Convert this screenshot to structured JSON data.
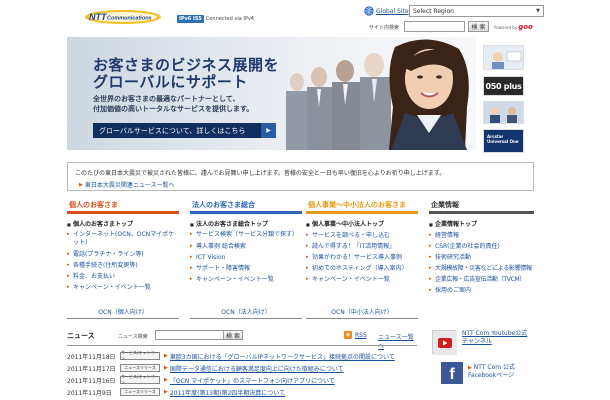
{
  "header": {
    "logo_text": "NTT Communications",
    "ipv6_badge": "IPv6 ISS",
    "ipv6_status": "Connected via IPv4",
    "global_site_label": "Global Site",
    "region_select_value": "Select Region",
    "site_search_label": "サイト内検索",
    "site_search_placeholder": "",
    "search_button": "検 索",
    "powered_by_label": "Powered by",
    "powered_by_brand": "goo"
  },
  "hero": {
    "title_line1": "お客さまのビジネス展開を",
    "title_line2": "グローバルにサポート",
    "sub_line1": "全世界のお客さまの最適なパートナーとして、",
    "sub_line2": "付加価値の高いトータルなサービスを提供します。",
    "button_label": "グローバルサービスについて、詳しくはこちら",
    "button_arrow": "▶"
  },
  "side_banners": {
    "plus_label": "050 plus",
    "arcstar_label": "Arcstar Universal One"
  },
  "notice": {
    "text": "このたびの東日本大震災で被災された皆様に、謹んでお見舞い申し上げます。皆様の安全と一日も早い復旧を心よりお祈り申し上げます。",
    "link": "東日本大震災関連ニュース一覧へ"
  },
  "columns": [
    {
      "title": "個人のお客さま",
      "color": "#d9501f",
      "items": [
        "個人のお客さまトップ",
        "インターネット(OCN、OCNマイポケット)",
        "電話(プラチナ・ライン等)",
        "各種手続き(住所変更等)",
        "料金、お支払い",
        "キャンペーン・イベント一覧"
      ],
      "footer": "OCN（個人向け）"
    },
    {
      "title": "法人のお客さま総合",
      "color": "#2b67b8",
      "items": [
        "法人のお客さま総合トップ",
        "サービス検索（サービス分類で探す）",
        "導入事例 総合検索",
        "ICT Vision",
        "サポート・障害情報",
        "キャンペーン・イベント一覧"
      ],
      "footer": "OCN（法人向け）"
    },
    {
      "title": "個人事業〜中小法人のお客さま",
      "color": "#e69b17",
      "items": [
        "個人事業〜中小法人トップ",
        "サービスを調べる・申し込む",
        "読んで得する！「IT活用情報」",
        "効果がわかる！サービス導入事例",
        "初めてのホスティング（導入案内）",
        "キャンペーン・イベント一覧"
      ],
      "footer": "OCN（中小法人向け）"
    },
    {
      "title": "企業情報",
      "color": "#555555",
      "items": [
        "企業情報トップ",
        "経営情報",
        "CSR(企業の社会的責任)",
        "技術研究活動",
        "大規模故障・災害などによる影響情報",
        "企業広報・広告宣伝活動（TVCM）",
        "採用のご案内"
      ],
      "footer": ""
    }
  ],
  "news": {
    "title": "ニュース",
    "search_label": "ニュース検索",
    "search_button": "検 索",
    "rss_label": "RSS",
    "list_link": "ニュース一覧へ",
    "items": [
      {
        "date": "2011年11月18日",
        "badge": "サービス/キャンペーン",
        "text": "東欧3カ国における「グローバルIPネットワークサービス」接続拠点の開設について"
      },
      {
        "date": "2011年11月17日",
        "badge": "ニュースリリース",
        "text": "国際データ通信における顧客満足度向上に向けた取組みについて"
      },
      {
        "date": "2011年11月16日",
        "badge": "サービス/キャンペーン",
        "text": "「OCN マイポケット」のスマートフォン向けアプリについて"
      },
      {
        "date": "2011年11月9日",
        "badge": "ニュースリリース",
        "text": "2011年度(第13期)第2四半期決算について"
      }
    ]
  },
  "social": {
    "youtube_label": "NTT Com Youtube公式チャンネル",
    "facebook_label": "NTT Com 公式 Facebookページ",
    "facebook_icon": "f"
  }
}
